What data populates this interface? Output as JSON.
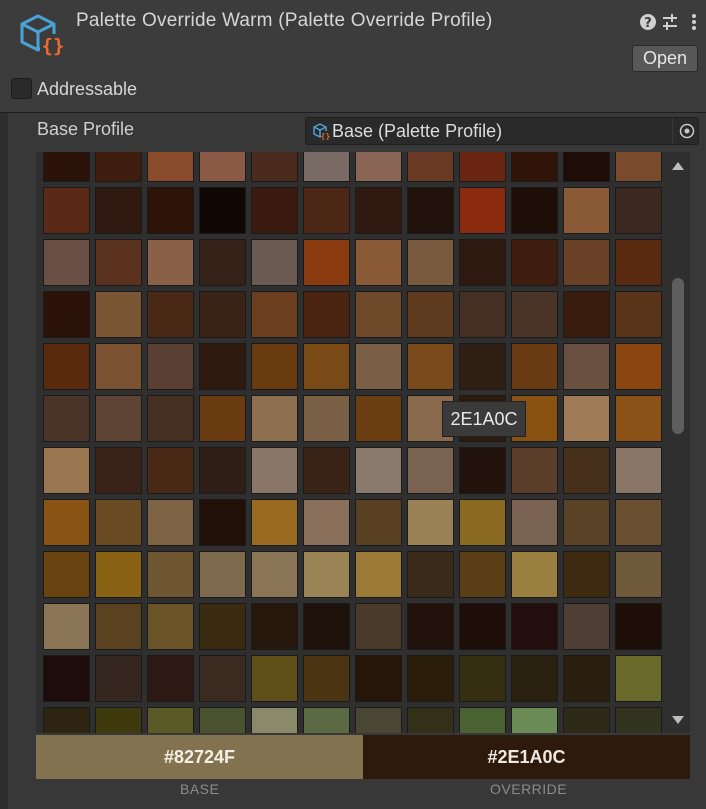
{
  "header": {
    "title": "Palette Override Warm (Palette Override Profile)",
    "open_label": "Open",
    "icons": [
      "asset-cube-icon",
      "help-icon",
      "sliders-icon",
      "kebab-menu-icon"
    ]
  },
  "addressable": {
    "label": "Addressable",
    "checked": false
  },
  "base_profile": {
    "label": "Base Profile",
    "value": "Base (Palette Profile)",
    "icons": [
      "asset-cube-icon",
      "object-picker-icon"
    ]
  },
  "palette": {
    "columns": 12,
    "tooltip": "2E1A0C",
    "swatches": [
      [
        "#2a1208",
        "#3e1c0e",
        "#8a4a2c",
        "#8a5a44",
        "#4a2a1c",
        "#7a6a66",
        "#8a6454",
        "#6a3a24",
        "#6a2412",
        "#301408",
        "#1e0c06",
        "#7a4a2c"
      ],
      [
        "#5a2a16",
        "#2e1810",
        "#2e1408",
        "#100604",
        "#3a1a0e",
        "#4e2816",
        "#2e1810",
        "#22120c",
        "#8a2a0e",
        "#1e0e08",
        "#8a5a36",
        "#3c2820"
      ],
      [
        "#6a5044",
        "#5a321e",
        "#8a6048",
        "#342218",
        "#6a5a52",
        "#8a3c10",
        "#8a5a36",
        "#7a5a3e",
        "#2e1a10",
        "#3e1c0e",
        "#6a4026",
        "#5a2a10"
      ],
      [
        "#2a1208",
        "#7a5634",
        "#4a2a16",
        "#3a2418",
        "#6a3e1e",
        "#4a2410",
        "#6e4a2a",
        "#5e3a1e",
        "#463024",
        "#4a3428",
        "#3a1c0e",
        "#5a3418"
      ],
      [
        "#5a2a0e",
        "#7a5232",
        "#5a4032",
        "#2e1a0e",
        "#6a3a10",
        "#7a4a16",
        "#7a5e46",
        "#7a4a1a",
        "#2e1e14",
        "#6a3a12",
        "#6a5040",
        "#8a4610"
      ],
      [
        "#4a3428",
        "#5e4434",
        "#463022",
        "#6a3a10",
        "#8e7050",
        "#7a6044",
        "#6a3e10",
        "#8a6a4c",
        "#2e1a0c",
        "#8a5210",
        "#9e7a56",
        "#8a5216"
      ],
      [
        "#9a7650",
        "#3a2218",
        "#4a2a16",
        "#2e1e16",
        "#8a7666",
        "#3a2418",
        "#8a7a6e",
        "#7a6250",
        "#22140c",
        "#5a3e2a",
        "#46301c",
        "#8a7666"
      ],
      [
        "#8a5414",
        "#6a4a22",
        "#7e6244",
        "#201008",
        "#9a6a20",
        "#8a705a",
        "#5a4022",
        "#9a8256",
        "#8a6a20",
        "#7a6252",
        "#5a4226",
        "#6a5030"
      ],
      [
        "#6a4410",
        "#8a6214",
        "#6e5632",
        "#7e6a4c",
        "#8a7656",
        "#9a8456",
        "#9a7a34",
        "#3a2a1a",
        "#5a3e16",
        "#9a8040",
        "#3e2a10",
        "#6e5a3a"
      ],
      [
        "#8a7656",
        "#5a4220",
        "#6a5428",
        "#3a2a10",
        "#26180c",
        "#1e100a",
        "#4a3a2a",
        "#22120c",
        "#1e0e0a",
        "#220e0c",
        "#4e3e36",
        "#1e0e0a"
      ],
      [
        "#1e0c0a",
        "#362620",
        "#2e1a14",
        "#3a2a20",
        "#5e5018",
        "#4a3412",
        "#26160a",
        "#2a1e0a",
        "#362e10",
        "#2a2010",
        "#2a1e0e",
        "#6a6a2a"
      ],
      [
        "#2e2412",
        "#3e3a0e",
        "#5a5a26",
        "#4a5230",
        "#8a8a6a",
        "#5a6a42",
        "#4a4634",
        "#323018",
        "#4a6232",
        "#6a8a56",
        "#2e2a18",
        "#323420"
      ]
    ]
  },
  "compare": {
    "base_hex": "#82724F",
    "override_hex": "#2E1A0C",
    "base_caption": "BASE",
    "override_caption": "OVERRIDE",
    "base_color": "#82724F",
    "override_color": "#2E1A0C"
  },
  "colors": {
    "accent_icon_blue": "#4aa3d8",
    "accent_icon_orange": "#f06a30",
    "panel_bg": "#383838"
  }
}
